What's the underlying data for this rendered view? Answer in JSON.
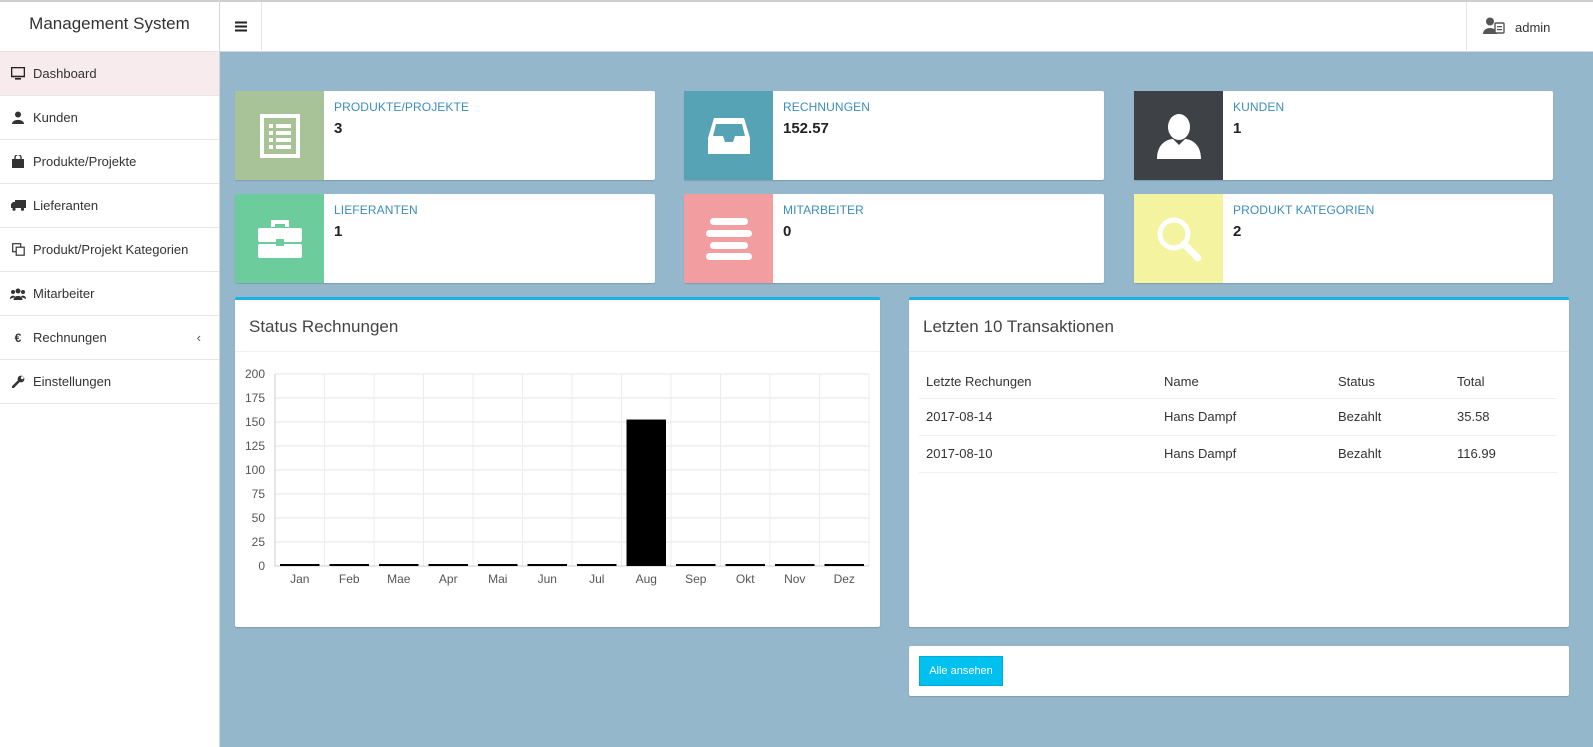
{
  "app": {
    "title": "Management System"
  },
  "topbar": {
    "user": "admin"
  },
  "sidebar": {
    "items": [
      {
        "label": "Dashboard",
        "icon": "monitor-icon"
      },
      {
        "label": "Kunden",
        "icon": "user-icon"
      },
      {
        "label": "Produkte/Projekte",
        "icon": "shopping-bag-icon"
      },
      {
        "label": "Lieferanten",
        "icon": "truck-icon"
      },
      {
        "label": "Produkt/Projekt Kategorien",
        "icon": "copy-icon"
      },
      {
        "label": "Mitarbeiter",
        "icon": "users-icon"
      },
      {
        "label": "Rechnungen",
        "icon": "euro-icon",
        "chevron": "‹"
      },
      {
        "label": "Einstellungen",
        "icon": "wrench-icon"
      }
    ]
  },
  "stats": [
    {
      "label": "PRODUKTE/PROJEKTE",
      "value": "3",
      "color": "#a8c398",
      "icon": "list-icon"
    },
    {
      "label": "RECHNUNGEN",
      "value": "152.57",
      "color": "#55a3b5",
      "icon": "inbox-icon"
    },
    {
      "label": "KUNDEN",
      "value": "1",
      "color": "#3e4145",
      "icon": "user-icon"
    },
    {
      "label": "LIEFERANTEN",
      "value": "1",
      "color": "#6dcc9b",
      "icon": "briefcase-icon"
    },
    {
      "label": "MITARBEITER",
      "value": "0",
      "color": "#f29ea0",
      "icon": "stack-icon"
    },
    {
      "label": "PRODUKT KATEGORIEN",
      "value": "2",
      "color": "#f3f3a0",
      "icon": "search-icon"
    }
  ],
  "chart_panel": {
    "title": "Status Rechnungen"
  },
  "chart_data": {
    "type": "bar",
    "categories": [
      "Jan",
      "Feb",
      "Mae",
      "Apr",
      "Mai",
      "Jun",
      "Jul",
      "Aug",
      "Sep",
      "Okt",
      "Nov",
      "Dez"
    ],
    "values": [
      0,
      0,
      0,
      0,
      0,
      0,
      0,
      152.57,
      0,
      0,
      0,
      0
    ],
    "ylim": [
      0,
      200
    ],
    "yticks": [
      "0",
      "25",
      "50",
      "75",
      "100",
      "125",
      "150",
      "175",
      "200"
    ],
    "bar_color": "#000000",
    "grid": true
  },
  "transactions": {
    "title": "Letzten 10 Transaktionen",
    "columns": [
      "Letzte Rechungen",
      "Name",
      "Status",
      "Total"
    ],
    "rows": [
      [
        "2017-08-14",
        "Hans Dampf",
        "Bezahlt",
        "35.58"
      ],
      [
        "2017-08-10",
        "Hans Dampf",
        "Bezahlt",
        "116.99"
      ]
    ],
    "button": "Alle ansehen"
  }
}
